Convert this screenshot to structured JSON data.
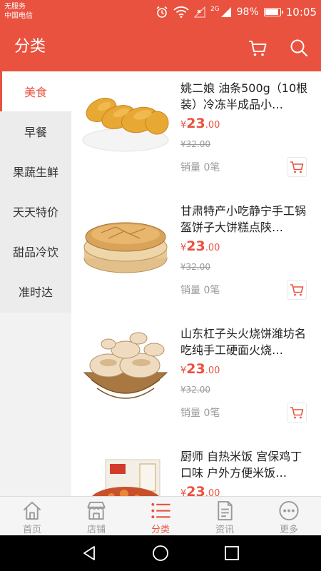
{
  "status_bar": {
    "carrier_line1": "无服务",
    "carrier_line2": "中国电信",
    "network": "2G",
    "battery": "98%",
    "time": "10:05"
  },
  "header": {
    "title": "分类",
    "cart_icon": "cart-icon",
    "search_icon": "search-icon"
  },
  "sidebar": {
    "items": [
      {
        "label": "美食",
        "active": true
      },
      {
        "label": "早餐",
        "active": false
      },
      {
        "label": "果蔬生鲜",
        "active": false
      },
      {
        "label": "天天特价",
        "active": false
      },
      {
        "label": "甜品冷饮",
        "active": false
      },
      {
        "label": "准时达",
        "active": false
      }
    ]
  },
  "products": [
    {
      "name": "姚二娘 油条500g（10根装）冷冻半成品小…",
      "currency": "¥",
      "price_int": "23",
      "price_dec": ".00",
      "old_price": "¥32.00",
      "sales": "销量 0笔"
    },
    {
      "name": "甘肃特产小吃静宁手工锅盔饼子大饼糕点陕…",
      "currency": "¥",
      "price_int": "23",
      "price_dec": ".00",
      "old_price": "¥32.00",
      "sales": "销量 0笔"
    },
    {
      "name": "山东杠子头火烧饼潍坊名吃纯手工硬面火烧…",
      "currency": "¥",
      "price_int": "23",
      "price_dec": ".00",
      "old_price": "¥32.00",
      "sales": "销量 0笔"
    },
    {
      "name": "厨师 自热米饭 宫保鸡丁口味 户外方便米饭…",
      "currency": "¥",
      "price_int": "23",
      "price_dec": ".00",
      "old_price": "",
      "sales": ""
    }
  ],
  "tabs": [
    {
      "label": "首页",
      "icon": "home-icon",
      "active": false
    },
    {
      "label": "店铺",
      "icon": "store-icon",
      "active": false
    },
    {
      "label": "分类",
      "icon": "list-icon",
      "active": true
    },
    {
      "label": "资讯",
      "icon": "news-icon",
      "active": false
    },
    {
      "label": "更多",
      "icon": "more-icon",
      "active": false
    }
  ],
  "colors": {
    "accent": "#e9523f",
    "tab_inactive": "#9a9a9a"
  }
}
